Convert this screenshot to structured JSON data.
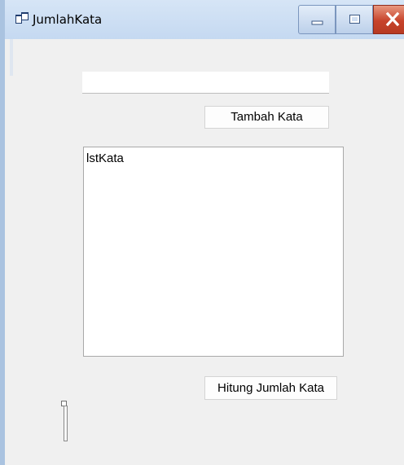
{
  "window": {
    "title": "JumlahKata"
  },
  "title_buttons": {
    "minimize_icon": "minimize-icon",
    "maximize_icon": "maximize-icon",
    "close_icon": "close-icon"
  },
  "form": {
    "word_input_value": "",
    "add_word_button_label": "Tambah Kata",
    "word_list_items": [
      "lstKata"
    ],
    "count_button_label": "Hitung Jumlah Kata"
  },
  "colors": {
    "titlebar": "#c5d9f1",
    "close_button": "#c7432b",
    "form_background": "#f0f0f0"
  }
}
